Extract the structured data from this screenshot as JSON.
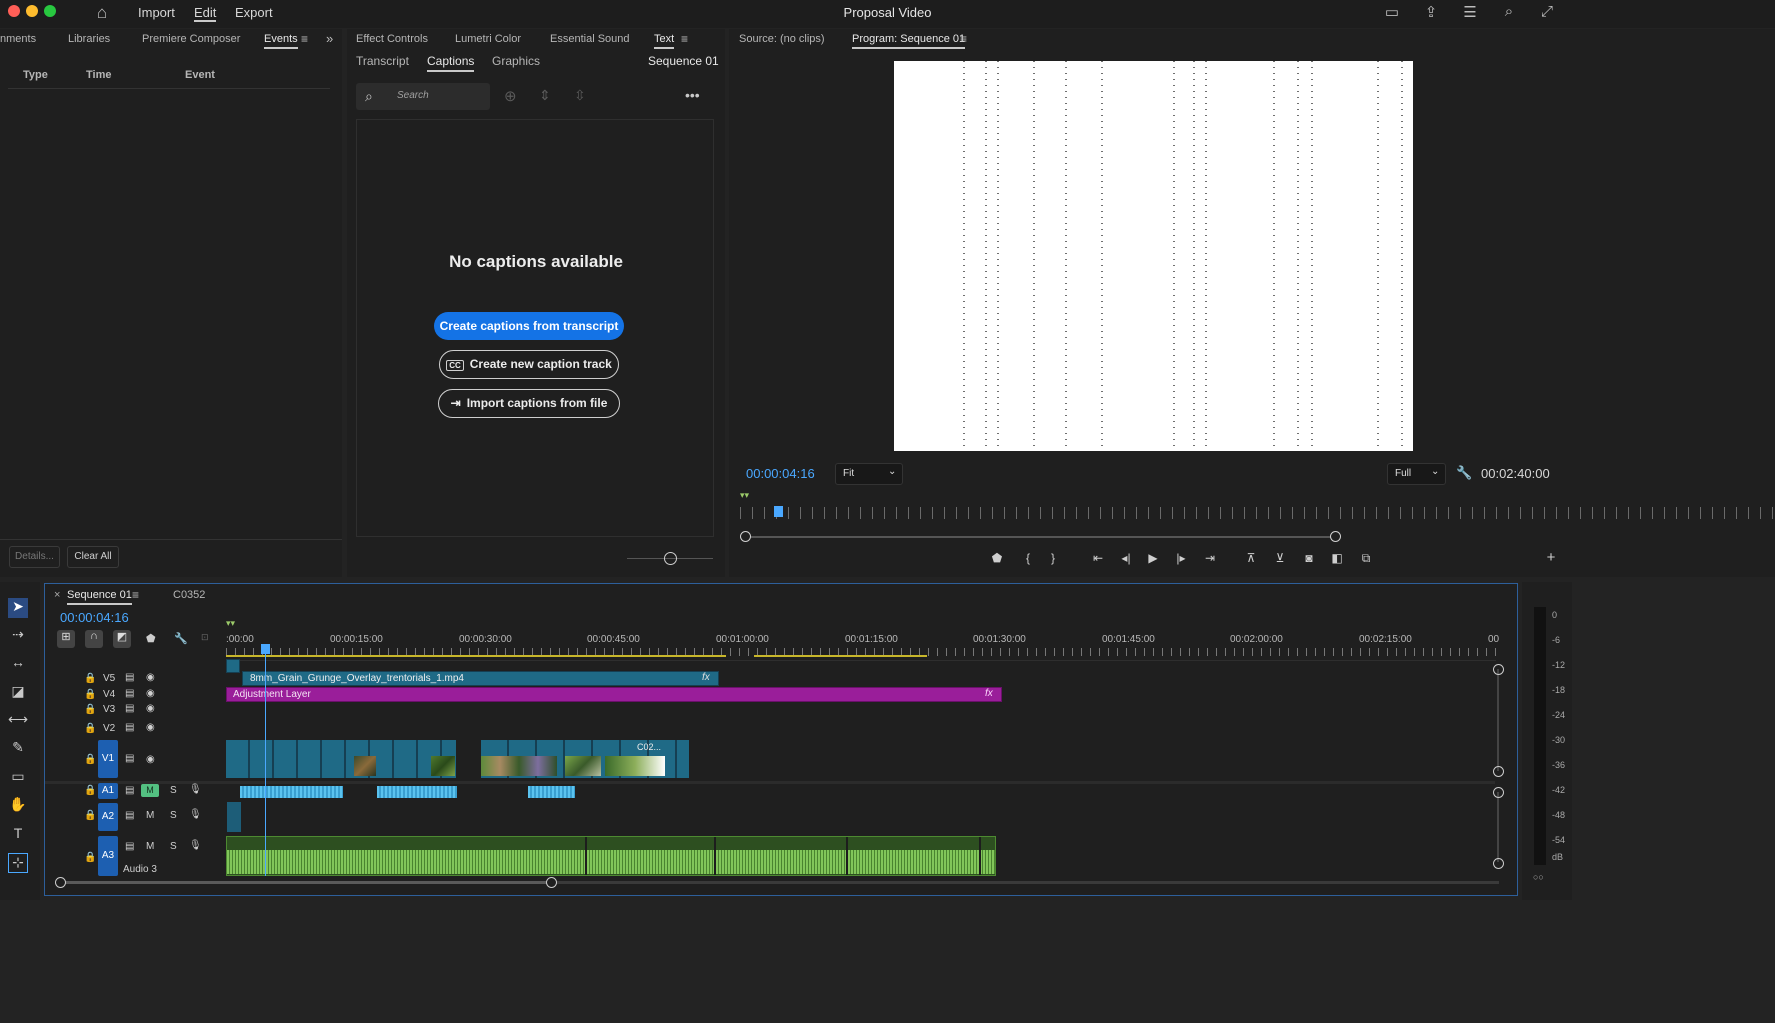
{
  "window": {
    "title": "Proposal Video"
  },
  "menu": {
    "import": "Import",
    "edit": "Edit",
    "export": "Export"
  },
  "left_panel": {
    "tabs": [
      "nments",
      "Libraries",
      "Premiere Composer",
      "Events"
    ],
    "columns": [
      "Type",
      "Time",
      "Event"
    ],
    "details_label": "Details...",
    "clear_all_label": "Clear All"
  },
  "text_panel": {
    "top_tabs": [
      "Effect Controls",
      "Lumetri Color",
      "Essential Sound",
      "Text"
    ],
    "sub_tabs": [
      "Transcript",
      "Captions",
      "Graphics"
    ],
    "sequence_label": "Sequence 01",
    "search_placeholder": "Search",
    "empty_title": "No captions available",
    "btn_create_from_transcript": "Create captions from transcript",
    "btn_new_track": "Create new caption track",
    "btn_import": "Import captions from file"
  },
  "monitor": {
    "source_tab": "Source: (no clips)",
    "program_tab": "Program: Sequence 01",
    "timecode": "00:00:04:16",
    "fit_value": "Fit",
    "quality_value": "Full",
    "duration": "00:02:40:00"
  },
  "timeline": {
    "tabs": [
      "Sequence 01",
      "C0352"
    ],
    "timecode": "00:00:04:16",
    "ruler": [
      ":00:00",
      "00:00:15:00",
      "00:00:30:00",
      "00:00:45:00",
      "00:01:00:00",
      "00:01:15:00",
      "00:01:30:00",
      "00:01:45:00",
      "00:02:00:00",
      "00:02:15:00",
      "00"
    ],
    "tracks": {
      "v5": "V5",
      "v4": "V4",
      "v3": "V3",
      "v2": "V2",
      "v1": "V1",
      "a1": "A1",
      "a2": "A2",
      "a3": "A3",
      "audio3_name": "Audio 3",
      "m": "M",
      "s": "S"
    },
    "clips": {
      "grain": "8mm_Grain_Grunge_Overlay_trentorials_1.mp4",
      "adjustment": "Adjustment Layer",
      "c02": "C02...",
      "fx": "fx"
    }
  },
  "meter": {
    "scale": [
      "0",
      "-6",
      "-12",
      "-18",
      "-24",
      "-30",
      "-36",
      "-42",
      "-48",
      "-54"
    ],
    "unit": "dB"
  },
  "colors": {
    "accent_blue": "#1473e6",
    "timecode_blue": "#4aa8ff",
    "adjustment_purple": "#9a1e9a",
    "video_clip": "#1f6a86",
    "audio_green": "#5a9a3a"
  }
}
